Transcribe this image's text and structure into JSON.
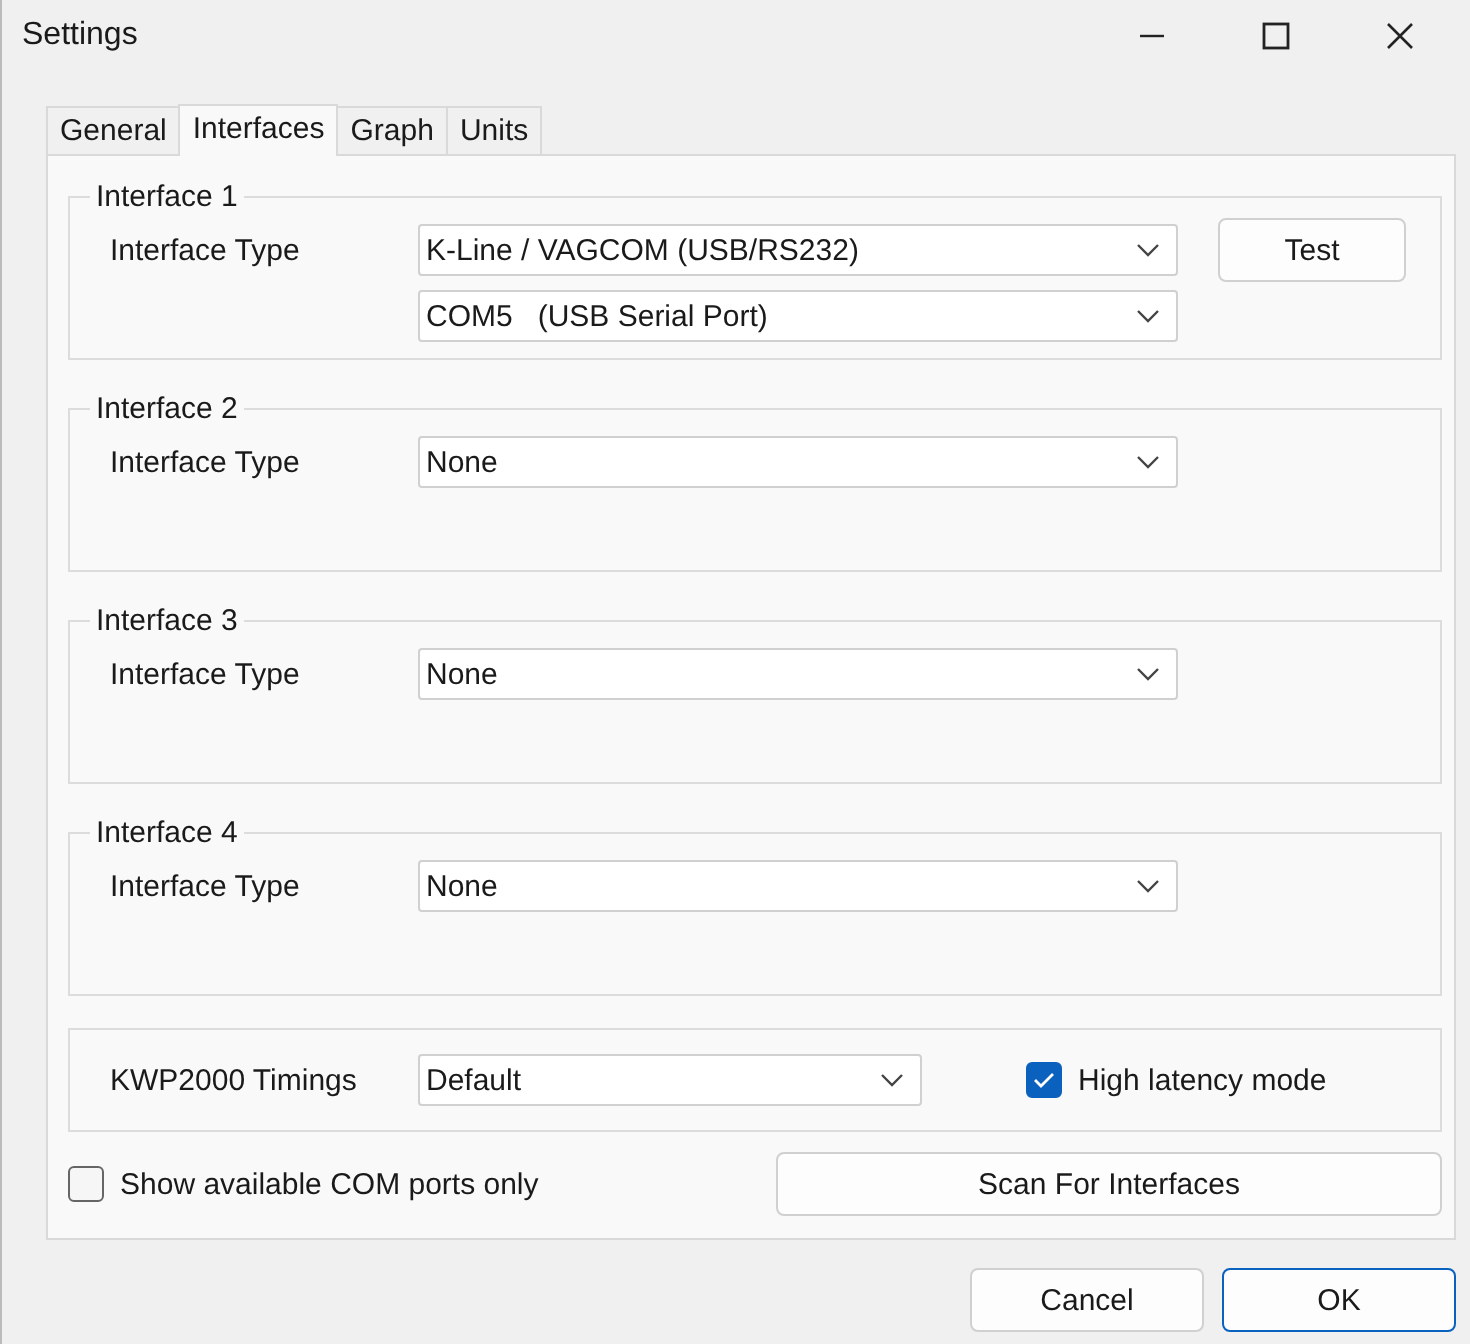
{
  "window": {
    "title": "Settings"
  },
  "tabs": [
    {
      "label": "General",
      "selected": false
    },
    {
      "label": "Interfaces",
      "selected": true
    },
    {
      "label": "Graph",
      "selected": false
    },
    {
      "label": "Units",
      "selected": false
    }
  ],
  "interfaces": [
    {
      "title": "Interface 1",
      "label": "Interface Type",
      "type": "K-Line / VAGCOM (USB/RS232)",
      "port": "COM5   (USB Serial Port)",
      "test_button": "Test"
    },
    {
      "title": "Interface 2",
      "label": "Interface Type",
      "type": "None"
    },
    {
      "title": "Interface 3",
      "label": "Interface Type",
      "type": "None"
    },
    {
      "title": "Interface 4",
      "label": "Interface Type",
      "type": "None"
    }
  ],
  "timings": {
    "label": "KWP2000 Timings",
    "value": "Default",
    "high_latency": {
      "label": "High latency mode",
      "checked": true
    }
  },
  "com_ports_only": {
    "label": "Show available COM ports only",
    "checked": false
  },
  "scan_button": "Scan For Interfaces",
  "buttons": [
    {
      "label": "Cancel",
      "kind": "normal"
    },
    {
      "label": "OK",
      "kind": "default"
    }
  ]
}
